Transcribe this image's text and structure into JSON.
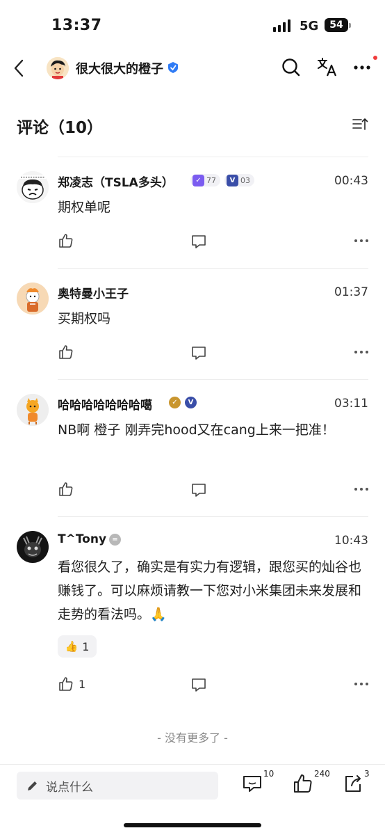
{
  "status_bar": {
    "time": "13:37",
    "network": "5G",
    "battery": "54"
  },
  "header": {
    "author_name": "很大很大的橙子",
    "icons": [
      "back-icon",
      "search-icon",
      "translate-icon",
      "more-icon"
    ]
  },
  "comments_section": {
    "title": "评论（10）"
  },
  "comments": [
    {
      "username": "郑凌志（TSLA多头）",
      "time": "00:43",
      "text": "期权单呢",
      "badge1_level": "77",
      "badge2_level": "03",
      "likes": ""
    },
    {
      "username": "奥特曼小王子",
      "time": "01:37",
      "text": "买期权吗",
      "likes": ""
    },
    {
      "username": "哈哈哈哈哈哈哈噶",
      "time": "03:11",
      "text": "NB啊 橙子 刚弄完hood又在cang上来一把准！",
      "likes": ""
    },
    {
      "username": "T^Tony",
      "time": "10:43",
      "text": "看您很久了，确实是有实力有逻辑，跟您买的灿谷也赚钱了。可以麻烦请教一下您对小米集团未来发展和走势的看法吗。🙏",
      "reaction_count": "1",
      "likes": "1"
    }
  ],
  "footer_note": "- 没有更多了 -",
  "bottom_bar": {
    "input_placeholder": "说点什么",
    "comment_count": "10",
    "like_count": "240",
    "share_count": "3"
  },
  "colors": {
    "verified_blue": "#2f7bf5",
    "badge_purple": "#7b5cf0",
    "badge_navy": "#3a4ea8",
    "badge_gold": "#c9962f",
    "muted_text": "#888888"
  }
}
